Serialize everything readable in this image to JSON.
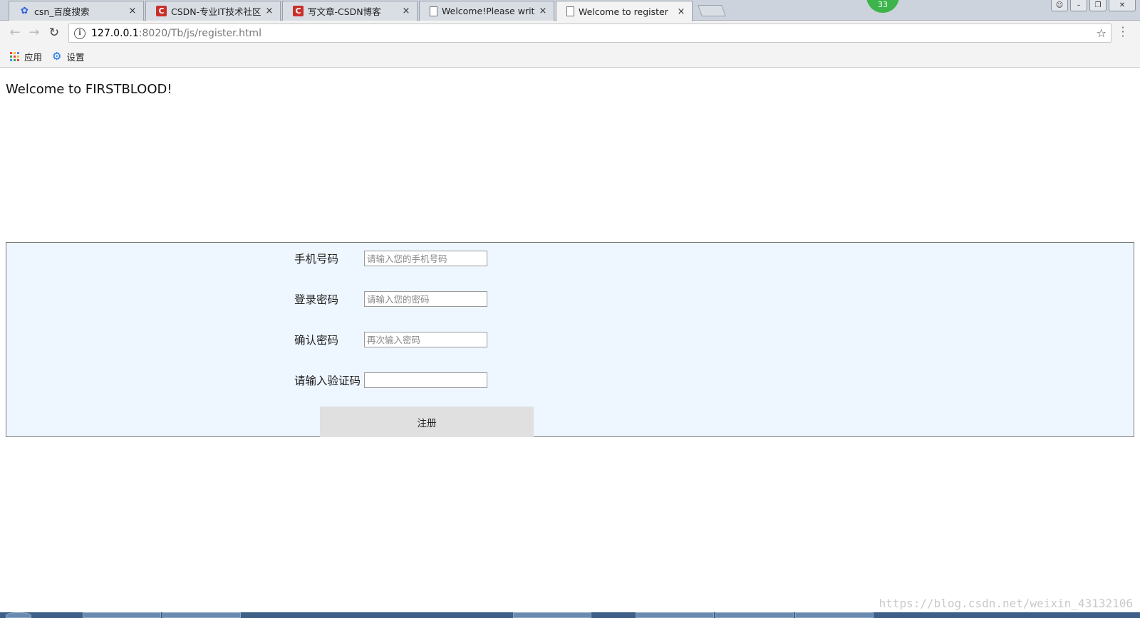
{
  "browser": {
    "tabs": [
      {
        "title": "csn_百度搜索",
        "favicon": "baidu-paw-icon",
        "active": false
      },
      {
        "title": "CSDN-专业IT技术社区",
        "favicon": "csdn-icon",
        "active": false
      },
      {
        "title": "写文章-CSDN博客",
        "favicon": "csdn-icon",
        "active": false
      },
      {
        "title": "Welcome!Please write y",
        "favicon": "document-icon",
        "active": false
      },
      {
        "title": "Welcome to register",
        "favicon": "document-icon",
        "active": true
      }
    ],
    "close_glyph": "×",
    "badge_count": "33",
    "url_host": "127.0.0.1",
    "url_path": ":8020/Tb/js/register.html",
    "bookmarks": [
      {
        "label": "应用",
        "icon": "apps-grid-icon"
      },
      {
        "label": "设置",
        "icon": "gear-icon"
      }
    ]
  },
  "page": {
    "heading": "Welcome to FIRSTBLOOD!",
    "form": {
      "phone": {
        "label": "手机号码",
        "placeholder": "请输入您的手机号码"
      },
      "password": {
        "label": "登录密码",
        "placeholder": "请输入您的密码"
      },
      "confirm": {
        "label": "确认密码",
        "placeholder": "再次输入密码"
      },
      "captcha": {
        "label": "请输入验证码",
        "placeholder": ""
      },
      "submit_label": "注册"
    },
    "panel_background": "#eef6ff"
  },
  "watermark": "https://blog.csdn.net/weixin_43132106"
}
